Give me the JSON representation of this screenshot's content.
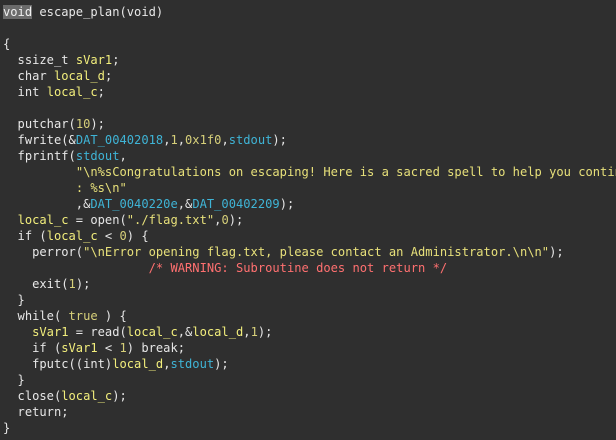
{
  "colors": {
    "background": "#2f2f2f",
    "text": "#e6e6e6",
    "variable": "#f2ee7c",
    "data_label": "#3fb4d6",
    "string": "#e7e07a",
    "comment": "#ff7070",
    "highlight": "#6b6b6b"
  },
  "lines": [
    [
      {
        "t": "void",
        "c": "hl"
      },
      {
        "t": " escape_plan(void)",
        "c": "fn"
      }
    ],
    [],
    [
      {
        "t": "{",
        "c": "plain"
      }
    ],
    [
      {
        "t": "  ssize_t ",
        "c": "kw"
      },
      {
        "t": "sVar1",
        "c": "var"
      },
      {
        "t": ";",
        "c": "plain"
      }
    ],
    [
      {
        "t": "  char ",
        "c": "kw"
      },
      {
        "t": "local_d",
        "c": "var"
      },
      {
        "t": ";",
        "c": "plain"
      }
    ],
    [
      {
        "t": "  int ",
        "c": "kw"
      },
      {
        "t": "local_c",
        "c": "var"
      },
      {
        "t": ";",
        "c": "plain"
      }
    ],
    [],
    [
      {
        "t": "  putchar(",
        "c": "fn"
      },
      {
        "t": "10",
        "c": "num"
      },
      {
        "t": ");",
        "c": "plain"
      }
    ],
    [
      {
        "t": "  fwrite(&",
        "c": "fn"
      },
      {
        "t": "DAT_00402018",
        "c": "data"
      },
      {
        "t": ",",
        "c": "plain"
      },
      {
        "t": "1",
        "c": "num"
      },
      {
        "t": ",",
        "c": "plain"
      },
      {
        "t": "0x1f0",
        "c": "num"
      },
      {
        "t": ",",
        "c": "plain"
      },
      {
        "t": "stdout",
        "c": "data"
      },
      {
        "t": ");",
        "c": "plain"
      }
    ],
    [
      {
        "t": "  fprintf(",
        "c": "fn"
      },
      {
        "t": "stdout",
        "c": "data"
      },
      {
        "t": ",",
        "c": "plain"
      }
    ],
    [
      {
        "t": "          ",
        "c": "plain"
      },
      {
        "t": "\"\\n%sCongratulations on escaping! Here is a sacred spell to help you continue",
        "c": "str"
      }
    ],
    [
      {
        "t": "          ",
        "c": "plain"
      },
      {
        "t": ": %s\\n\"",
        "c": "str"
      }
    ],
    [
      {
        "t": "          ,&",
        "c": "plain"
      },
      {
        "t": "DAT_0040220e",
        "c": "data"
      },
      {
        "t": ",&",
        "c": "plain"
      },
      {
        "t": "DAT_00402209",
        "c": "data"
      },
      {
        "t": ");",
        "c": "plain"
      }
    ],
    [
      {
        "t": "  ",
        "c": "plain"
      },
      {
        "t": "local_c",
        "c": "var"
      },
      {
        "t": " = open(",
        "c": "plain"
      },
      {
        "t": "\"./flag.txt\"",
        "c": "str"
      },
      {
        "t": ",",
        "c": "plain"
      },
      {
        "t": "0",
        "c": "num"
      },
      {
        "t": ");",
        "c": "plain"
      }
    ],
    [
      {
        "t": "  if (",
        "c": "kw"
      },
      {
        "t": "local_c",
        "c": "var"
      },
      {
        "t": " < ",
        "c": "plain"
      },
      {
        "t": "0",
        "c": "num"
      },
      {
        "t": ") {",
        "c": "plain"
      }
    ],
    [
      {
        "t": "    perror(",
        "c": "fn"
      },
      {
        "t": "\"\\nError opening flag.txt, please contact an Administrator.\\n\\n\"",
        "c": "str"
      },
      {
        "t": ");",
        "c": "plain"
      }
    ],
    [
      {
        "t": "                    ",
        "c": "plain"
      },
      {
        "t": "/* WARNING: Subroutine does not return */",
        "c": "cmt"
      }
    ],
    [
      {
        "t": "    exit(",
        "c": "fn"
      },
      {
        "t": "1",
        "c": "num"
      },
      {
        "t": ");",
        "c": "plain"
      }
    ],
    [
      {
        "t": "  }",
        "c": "plain"
      }
    ],
    [
      {
        "t": "  while( ",
        "c": "kw"
      },
      {
        "t": "true",
        "c": "num"
      },
      {
        "t": " ) {",
        "c": "plain"
      }
    ],
    [
      {
        "t": "    ",
        "c": "plain"
      },
      {
        "t": "sVar1",
        "c": "var"
      },
      {
        "t": " = read(",
        "c": "plain"
      },
      {
        "t": "local_c",
        "c": "var"
      },
      {
        "t": ",&",
        "c": "plain"
      },
      {
        "t": "local_d",
        "c": "var"
      },
      {
        "t": ",",
        "c": "plain"
      },
      {
        "t": "1",
        "c": "num"
      },
      {
        "t": ");",
        "c": "plain"
      }
    ],
    [
      {
        "t": "    if (",
        "c": "kw"
      },
      {
        "t": "sVar1",
        "c": "var"
      },
      {
        "t": " < ",
        "c": "plain"
      },
      {
        "t": "1",
        "c": "num"
      },
      {
        "t": ") break;",
        "c": "plain"
      }
    ],
    [
      {
        "t": "    fputc((int)",
        "c": "fn"
      },
      {
        "t": "local_d",
        "c": "var"
      },
      {
        "t": ",",
        "c": "plain"
      },
      {
        "t": "stdout",
        "c": "data"
      },
      {
        "t": ");",
        "c": "plain"
      }
    ],
    [
      {
        "t": "  }",
        "c": "plain"
      }
    ],
    [
      {
        "t": "  close(",
        "c": "fn"
      },
      {
        "t": "local_c",
        "c": "var"
      },
      {
        "t": ");",
        "c": "plain"
      }
    ],
    [
      {
        "t": "  return;",
        "c": "kw"
      }
    ],
    [
      {
        "t": "}",
        "c": "plain"
      }
    ]
  ]
}
